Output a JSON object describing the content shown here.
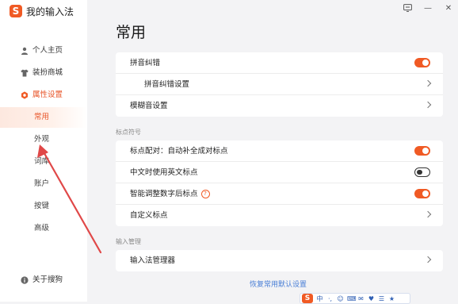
{
  "app": {
    "title": "我的输入法",
    "logo_char": "S"
  },
  "sidebar": {
    "items": [
      {
        "label": "个人主页",
        "icon": "user-icon"
      },
      {
        "label": "装扮商城",
        "icon": "shirt-icon"
      },
      {
        "label": "属性设置",
        "icon": "settings-icon",
        "active": true
      }
    ],
    "subitems": [
      {
        "label": "常用",
        "selected": true
      },
      {
        "label": "外观"
      },
      {
        "label": "词库"
      },
      {
        "label": "账户"
      },
      {
        "label": "按键"
      },
      {
        "label": "高级"
      }
    ],
    "about": {
      "label": "关于搜狗",
      "icon": "info-icon"
    }
  },
  "main": {
    "title": "常用",
    "group1": {
      "rows": [
        {
          "label": "拼音纠错",
          "control": "toggle",
          "on": true
        },
        {
          "label": "拼音纠错设置",
          "control": "chevron",
          "indent": true
        },
        {
          "label": "模糊音设置",
          "control": "chevron"
        }
      ]
    },
    "group2": {
      "label": "标点符号",
      "rows": [
        {
          "label": "标点配对：自动补全成对标点",
          "control": "toggle",
          "on": true
        },
        {
          "label": "中文时使用英文标点",
          "control": "toggle",
          "on": false
        },
        {
          "label": "智能调整数字后标点",
          "control": "toggle",
          "on": true,
          "help": "?"
        },
        {
          "label": "自定义标点",
          "control": "chevron"
        }
      ]
    },
    "group3": {
      "label": "输入管理",
      "rows": [
        {
          "label": "输入法管理器",
          "control": "chevron"
        }
      ]
    },
    "restore_link": "恢复常用默认设置"
  },
  "titlebar": {
    "icons": [
      "menu-box-icon",
      "minimize-icon",
      "close-icon"
    ],
    "minimize": "—",
    "close": "✕"
  },
  "statusbar": {
    "logo": "S",
    "mode": "中",
    "items": [
      "·,",
      "☺",
      "⌨",
      "✉",
      "♥",
      "☰",
      "★"
    ]
  },
  "colors": {
    "accent": "#f05a24",
    "link": "#4a7fd6",
    "annotation": "#e04848"
  }
}
